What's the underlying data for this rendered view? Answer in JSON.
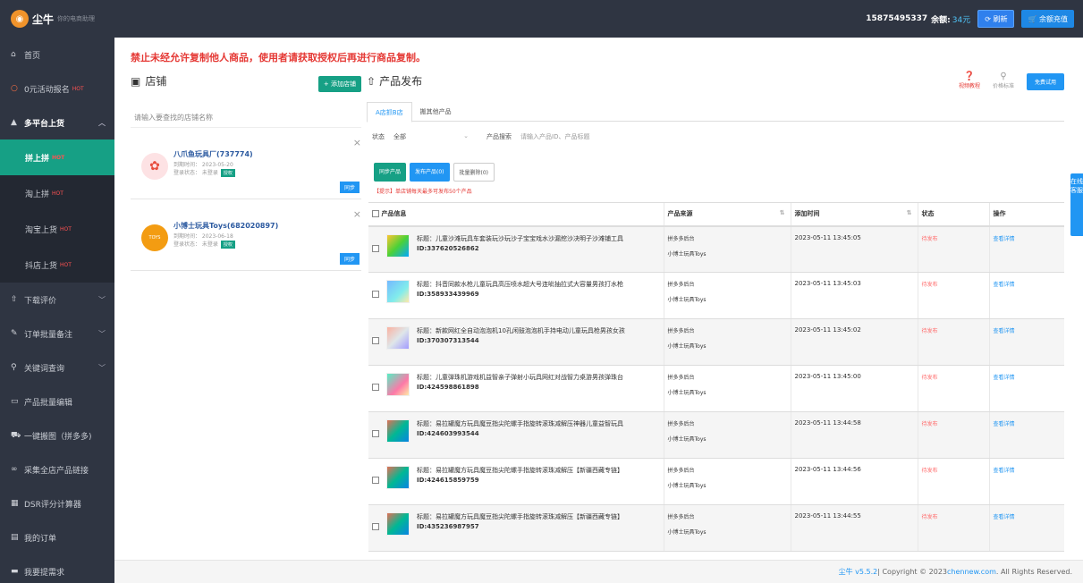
{
  "topbar": {
    "logo_text": "尘牛",
    "slogan": "你的电商助理",
    "phone": "15875495337",
    "balance_label": "余额:",
    "balance_value": "34元",
    "refresh_label": "刷新",
    "recharge_label": "余额充值"
  },
  "sidebar": {
    "items": [
      {
        "label": "首页"
      },
      {
        "label": "0元活动报名",
        "hot": "HOT"
      },
      {
        "label": "多平台上货"
      },
      {
        "label": "拼上拼",
        "hot": "HOT"
      },
      {
        "label": "淘上拼",
        "hot": "HOT"
      },
      {
        "label": "淘宝上货",
        "hot": "HOT"
      },
      {
        "label": "抖店上货",
        "hot": "HOT"
      },
      {
        "label": "下载评价"
      },
      {
        "label": "订单批量备注"
      },
      {
        "label": "关键词查询"
      },
      {
        "label": "产品批量编辑"
      },
      {
        "label": "一键搬图（拼多多)"
      },
      {
        "label": "采集全店产品链接"
      },
      {
        "label": "DSR评分计算器"
      },
      {
        "label": "我的订单"
      },
      {
        "label": "我要提需求"
      }
    ]
  },
  "warning": "禁止未经允许复制他人商品，使用者请获取授权后再进行商品复制。",
  "shop_panel": {
    "title": "店铺",
    "add_label": "+ 添加店铺",
    "search_placeholder": "请输入要查找的店铺名称",
    "shops": [
      {
        "name": "八爪鱼玩具厂(737774)",
        "expire": "到期时间： 2023-05-20",
        "login": "登录状态： 未登录",
        "auth": "授权",
        "sync": "同步"
      },
      {
        "name": "小博士玩具Toys(682020897)",
        "expire": "到期时间： 2023-06-18",
        "login": "登录状态： 未登录",
        "auth": "授权",
        "sync": "同步"
      }
    ]
  },
  "product_panel": {
    "title": "产品发布",
    "video_label": "视频教程",
    "price_label": "价格标准",
    "trial_label": "免费试用",
    "tabs": [
      "A店抓B店",
      "搬其他产品"
    ],
    "filter_status_label": "状态",
    "filter_status_value": "全部",
    "filter_search_label": "产品搜索",
    "filter_search_placeholder": "请输入产品ID、产品标题",
    "btn_sync": "同步产品",
    "btn_publish": "发布产品(0)",
    "btn_delete": "批量删除(0)",
    "tip": "【提示】单店铺每天最多可发布50个产品",
    "columns": [
      "产品信息",
      "产品来源",
      "添加时间",
      "状态",
      "操作"
    ],
    "rows": [
      {
        "title": "标题：儿童沙滩玩具车套装玩沙玩沙子宝宝戏水沙漏挖沙决明子沙滩铺工具",
        "id": "ID:337620526862",
        "src1": "拼多多后台",
        "src2": "小博士玩具Toys",
        "time": "2023-05-11 13:45:05",
        "status": "待发布",
        "op": "查看详情"
      },
      {
        "title": "标题：抖音同款水枪儿童玩具高压喷水超大号连呲抽拉式大容量男孩打水枪",
        "id": "ID:358933439969",
        "src1": "拼多多后台",
        "src2": "小博士玩具Toys",
        "time": "2023-05-11 13:45:03",
        "status": "待发布",
        "op": "查看详情"
      },
      {
        "title": "标题：新款网红全自动泡泡机10孔闲鼓泡泡机手持电动儿童玩具枪男孩女孩",
        "id": "ID:370307313544",
        "src1": "拼多多后台",
        "src2": "小博士玩具Toys",
        "time": "2023-05-11 13:45:02",
        "status": "待发布",
        "op": "查看详情"
      },
      {
        "title": "标题：儿童弹珠机游戏机益智亲子弹射小玩具网红对战智力桌游男孩弹珠台",
        "id": "ID:424598861898",
        "src1": "拼多多后台",
        "src2": "小博士玩具Toys",
        "time": "2023-05-11 13:45:00",
        "status": "待发布",
        "op": "查看详情"
      },
      {
        "title": "标题：易拉罐魔方玩具魔豆指尖陀螺手指旋转滚珠减解压神器儿童益智玩具",
        "id": "ID:424603993544",
        "src1": "拼多多后台",
        "src2": "小博士玩具Toys",
        "time": "2023-05-11 13:44:58",
        "status": "待发布",
        "op": "查看详情"
      },
      {
        "title": "标题：易拉罐魔方玩具魔豆指尖陀螺手指旋转滚珠减解压【新疆西藏专链】",
        "id": "ID:424615859759",
        "src1": "拼多多后台",
        "src2": "小博士玩具Toys",
        "time": "2023-05-11 13:44:56",
        "status": "待发布",
        "op": "查看详情"
      },
      {
        "title": "标题：易拉罐魔方玩具魔豆指尖陀螺手指旋转滚珠减解压【新疆西藏专链】",
        "id": "ID:435236987957",
        "src1": "拼多多后台",
        "src2": "小博士玩具Toys",
        "time": "2023-05-11 13:44:55",
        "status": "待发布",
        "op": "查看详情"
      }
    ]
  },
  "float_service": "在线客服",
  "footer": {
    "version": "尘牛 v5.5.2",
    "copyright": " | Copyright © 2023 ",
    "link": "chennew.com",
    "rights": " . All Rights Reserved."
  }
}
